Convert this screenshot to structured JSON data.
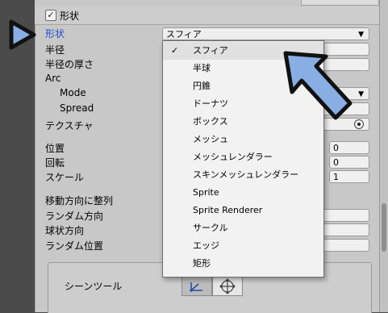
{
  "section": {
    "checked": "✓",
    "title": "形状"
  },
  "shape": {
    "label": "形状",
    "value": "スフィア"
  },
  "properties": [
    {
      "label": "半径"
    },
    {
      "label": "半径の厚さ"
    },
    {
      "label": "Arc"
    },
    {
      "label": "Mode"
    },
    {
      "label": "Spread"
    },
    {
      "label": "テクスチャ"
    },
    {
      "label": "位置",
      "value": "0"
    },
    {
      "label": "回転",
      "value": "0"
    },
    {
      "label": "スケール",
      "value": "1"
    },
    {
      "label": "移動方向に整列"
    },
    {
      "label": "ランダム方向"
    },
    {
      "label": "球状方向"
    },
    {
      "label": "ランダム位置"
    }
  ],
  "popup": {
    "check_mark": "✓",
    "items": [
      "スフィア",
      "半球",
      "円錐",
      "ドーナツ",
      "ボックス",
      "メッシュ",
      "メッシュレンダラー",
      "スキンメッシュレンダラー",
      "Sprite",
      "Sprite Renderer",
      "サークル",
      "エッジ",
      "矩形"
    ],
    "selected_index": 0
  },
  "scene_tools": {
    "label": "シーンツール"
  },
  "colors": {
    "panel": "#c8c8c8",
    "background": "#4b4b4b",
    "highlight_text": "#1f4ed1",
    "pointer_fill": "#88aee4",
    "pointer_stroke": "#111111"
  },
  "icons": {
    "pointer_triangle": "pointer-triangle-icon",
    "pointer_arrow": "pointer-arrow-icon",
    "dropdown_arrow": "dropdown-arrow-icon",
    "tool_edit": "shape-edit-icon",
    "tool_move": "move-tool-icon"
  }
}
